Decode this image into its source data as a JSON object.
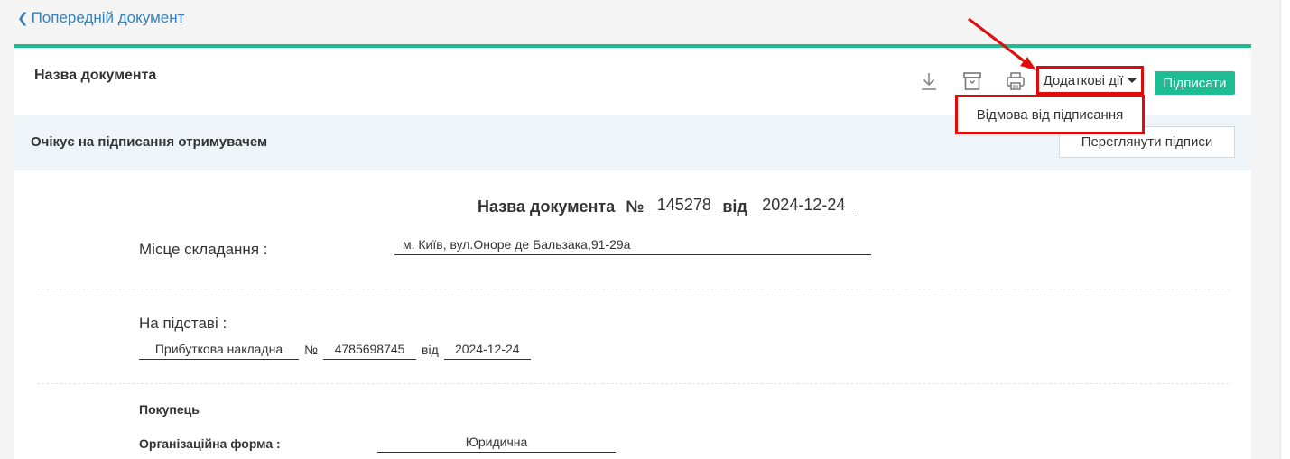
{
  "nav": {
    "back_label": "Попередній документ"
  },
  "header": {
    "title": "Назва документа",
    "actions_label": "Додаткові дії",
    "sign_label": "Підписати",
    "menu_item_refuse": "Відмова від підписання"
  },
  "status": {
    "text": "Очікує на підписання отримувачем",
    "view_signatures_label": "Переглянути підписи"
  },
  "document": {
    "title": "Назва документа",
    "number_sign": "№",
    "number": "145278",
    "from_label": "від",
    "date": "2024-12-24",
    "place_label": "Місце складання :",
    "place_value": "м. Київ, вул.Оноре де Бальзака,91-29а",
    "basis_label": "На підставі :",
    "basis_doc": "Прибуткова накладна",
    "basis_number_sign": "№",
    "basis_number": "4785698745",
    "basis_from_label": "від",
    "basis_date": "2024-12-24",
    "buyer_label": "Покупець",
    "org_form_label": "Організаційна форма :",
    "org_form_value": "Юридична"
  },
  "colors": {
    "accent": "#1dbc93",
    "highlight": "#e00b0b",
    "link": "#3a7fb8",
    "status_bg": "#eff4f8"
  },
  "icons": [
    "chevron-left-icon",
    "download-icon",
    "archive-icon",
    "print-icon",
    "caret-down-icon",
    "annotation-arrow"
  ]
}
